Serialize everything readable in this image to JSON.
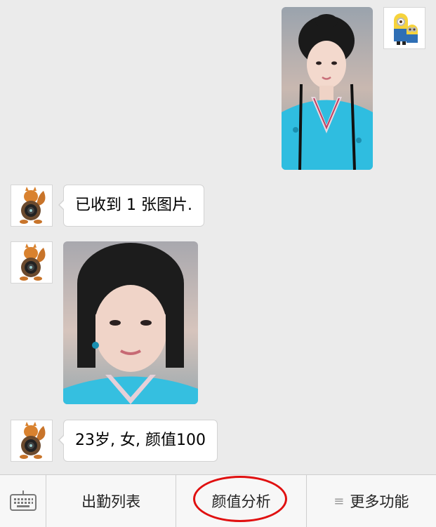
{
  "messages": {
    "received_text_1": "已收到 1 张图片.",
    "received_text_2": "23岁, 女, 颜值100"
  },
  "toolbar": {
    "item1": "出勤列表",
    "item2": "颜值分析",
    "item3": "更多功能"
  },
  "colors": {
    "background": "#ebebeb",
    "highlight_circle": "#e01010"
  }
}
